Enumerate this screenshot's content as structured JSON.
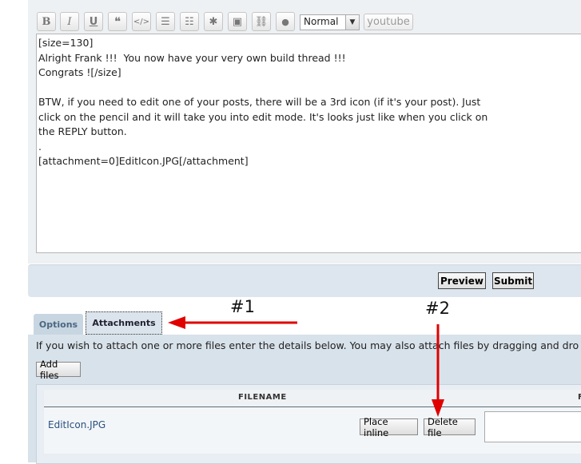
{
  "toolbar": {
    "buttons": [
      {
        "name": "bold-button",
        "glyph": "B"
      },
      {
        "name": "italic-button",
        "glyph": "I"
      },
      {
        "name": "underline-button",
        "glyph": "U"
      },
      {
        "name": "quote-button",
        "glyph": "❝"
      },
      {
        "name": "code-button",
        "glyph": "</>"
      },
      {
        "name": "unordered-list-button",
        "glyph": "☰"
      },
      {
        "name": "ordered-list-button",
        "glyph": "☷"
      },
      {
        "name": "special-char-button",
        "glyph": "✱"
      },
      {
        "name": "image-button",
        "glyph": "▣"
      },
      {
        "name": "link-button",
        "glyph": "⛓"
      },
      {
        "name": "color-button",
        "glyph": "●"
      }
    ],
    "size_select_value": "Normal",
    "youtube_label": "youtube"
  },
  "editor": {
    "content": "[size=130]\nAlright Frank !!!  You now have your very own build thread !!!\nCongrats ![/size]\n\nBTW, if you need to edit one of your posts, there will be a 3rd icon (if it's your post). Just\nclick on the pencil and it will take you into edit mode. It's looks just like when you click on\nthe REPLY button.\n.\n[attachment=0]EditIcon.JPG[/attachment]"
  },
  "actions": {
    "preview_label": "Preview",
    "submit_label": "Submit"
  },
  "tabs": {
    "options_label": "Options",
    "attachments_label": "Attachments"
  },
  "attachments": {
    "description": "If you wish to attach one or more files enter the details below. You may also attach files by dragging and dro",
    "add_files_label": "Add files",
    "column_filename": "FILENAME",
    "column_cut": "F",
    "file": {
      "name": "EditIcon.JPG",
      "place_inline_label": "Place inline",
      "delete_label": "Delete file"
    }
  },
  "annotations": {
    "marker_1": "#1",
    "marker_2": "#2",
    "arrow_color": "#e00000"
  }
}
